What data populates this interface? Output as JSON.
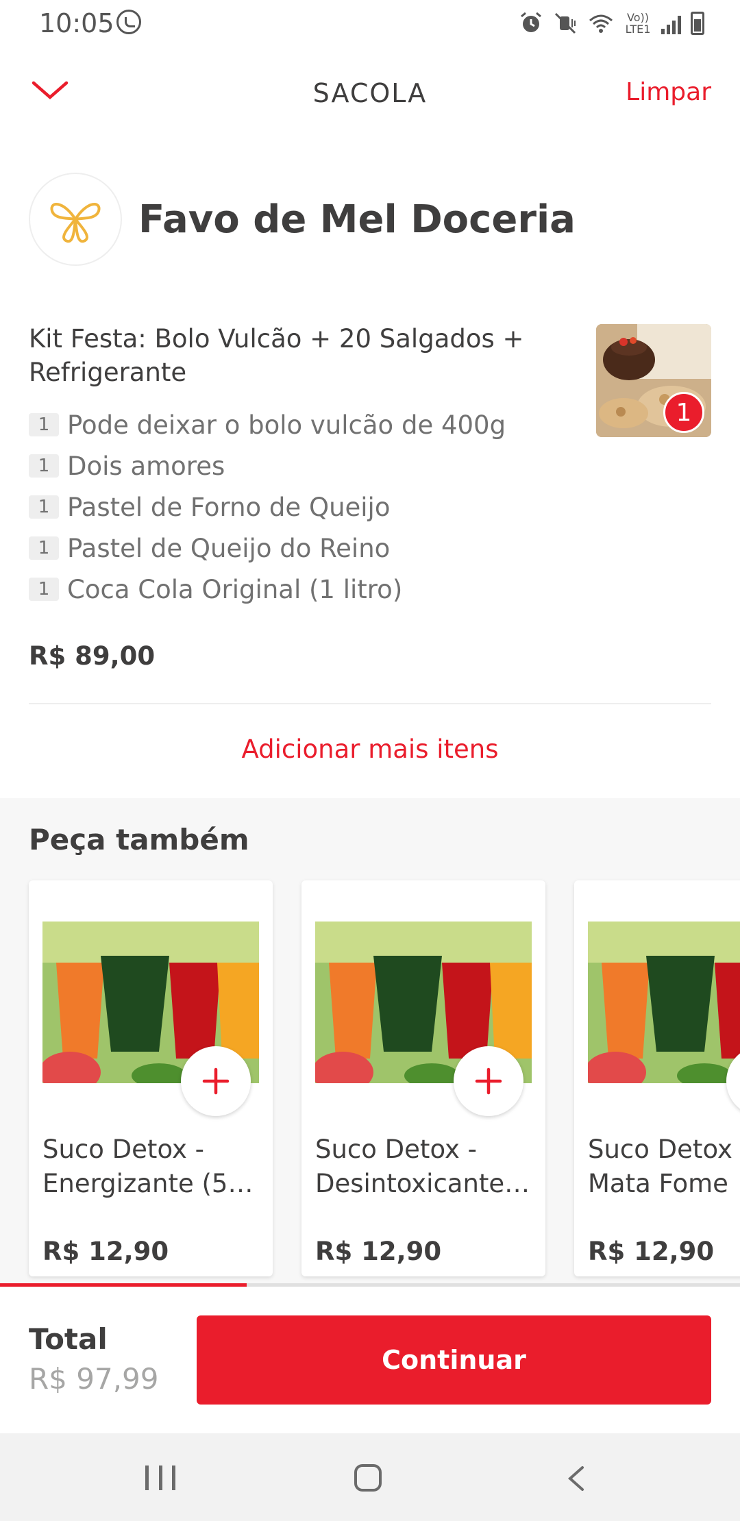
{
  "status_bar": {
    "time": "10:05",
    "icons": [
      "whatsapp-icon",
      "alarm-icon",
      "mute-icon",
      "wifi-icon",
      "volte-icon",
      "signal-icon",
      "battery-icon"
    ],
    "volte_label": "Vo)) LTE1"
  },
  "header": {
    "title": "SACOLA",
    "clear_label": "Limpar",
    "back_icon": "chevron-down-icon"
  },
  "store": {
    "name": "Favo de Mel Doceria"
  },
  "cart_item": {
    "title": "Kit Festa: Bolo Vulcão + 20 Salgados + Refrigerante",
    "quantity_badge": "1",
    "sub_items": [
      {
        "qty": "1",
        "name": "Pode deixar o bolo vulcão de 400g"
      },
      {
        "qty": "1",
        "name": "Dois amores"
      },
      {
        "qty": "1",
        "name": "Pastel de Forno de Queijo"
      },
      {
        "qty": "1",
        "name": "Pastel de Queijo do Reino"
      },
      {
        "qty": "1",
        "name": "Coca Cola Original (1 litro)"
      }
    ],
    "price": "R$ 89,00"
  },
  "add_more_label": "Adicionar mais itens",
  "suggestions": {
    "title": "Peça também",
    "items": [
      {
        "name": "Suco Detox - Energizante (5…",
        "price": "R$ 12,90"
      },
      {
        "name": "Suco Detox - Desintoxicante…",
        "price": "R$ 12,90"
      },
      {
        "name": "Suco Detox - Mata Fome",
        "price": "R$ 12,90"
      }
    ]
  },
  "footer": {
    "total_label": "Total",
    "total_value": "R$ 97,99",
    "continue_label": "Continuar"
  },
  "colors": {
    "accent": "#ea1d2c",
    "text": "#3f3e3e",
    "muted": "#717171"
  }
}
